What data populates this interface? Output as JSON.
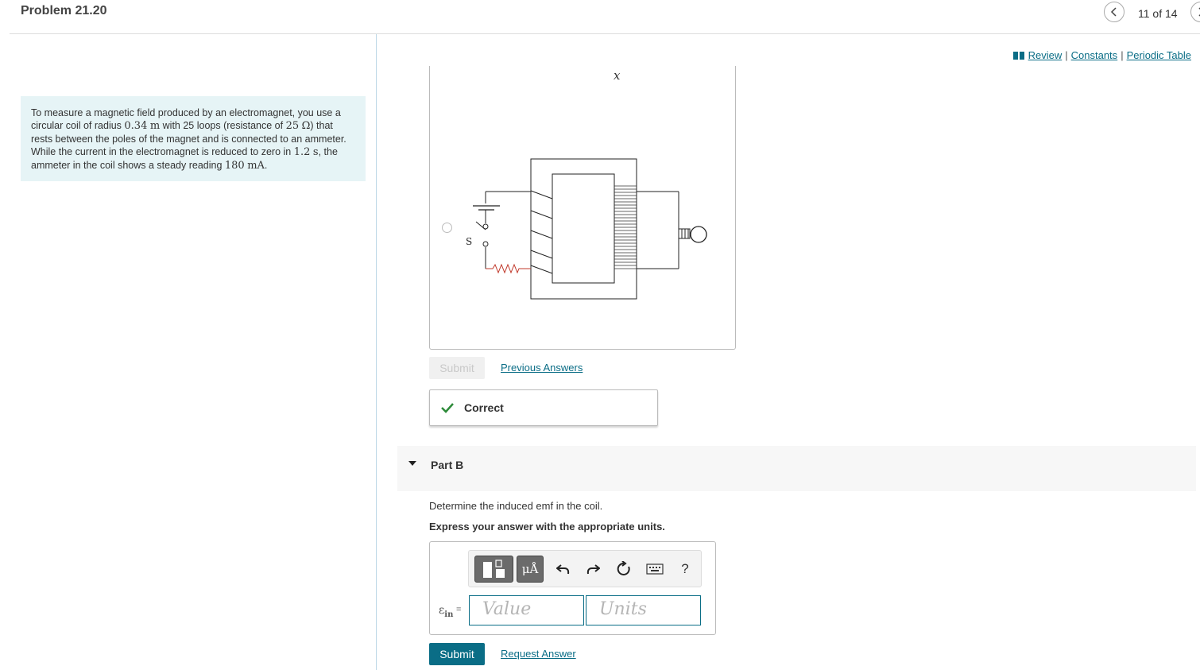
{
  "header": {
    "title": "Problem 21.20",
    "counter": "11 of 14",
    "prev_icon": "chevron-left-icon",
    "next_icon": "chevron-right-icon"
  },
  "links": {
    "review": "Review",
    "constants": "Constants",
    "periodic_table": "Periodic Table",
    "sep": "|"
  },
  "problem": {
    "t1": "To measure a magnetic field produced by an electromagnet, you use a circular coil of radius ",
    "radius_value": "0.34",
    "radius_unit": "m",
    "t2": " with 25 loops (resistance of ",
    "resistance_value": "25",
    "resistance_unit": "Ω",
    "t3": ") that rests between the poles of the magnet and is connected to an ammeter. While the current in the electromagnet is reduced to zero in ",
    "time_value": "1.2",
    "time_unit": "s",
    "t4": ", the ammeter in the coil shows a steady reading ",
    "current_value": "180",
    "current_unit": "mA",
    "t5": "."
  },
  "part_a": {
    "figure_label_x": "x",
    "switch_label": "S",
    "submit_label": "Submit",
    "previous_answers": "Previous Answers",
    "feedback": "Correct"
  },
  "part_b": {
    "label": "Part B",
    "question": "Determine the induced emf in the coil.",
    "instruction": "Express your answer with the appropriate units.",
    "toolbar": {
      "help_label": "?",
      "units_symbol": "μÅ"
    },
    "emf_symbol": "ε",
    "emf_subscript": "in",
    "equals": "=",
    "value_placeholder": "Value",
    "units_placeholder": "Units",
    "submit_label": "Submit",
    "request_answer": "Request Answer"
  },
  "colors": {
    "accent": "#0a6d86",
    "problem_bg": "#e6f4f6",
    "correct_check": "#2e8b3a"
  }
}
